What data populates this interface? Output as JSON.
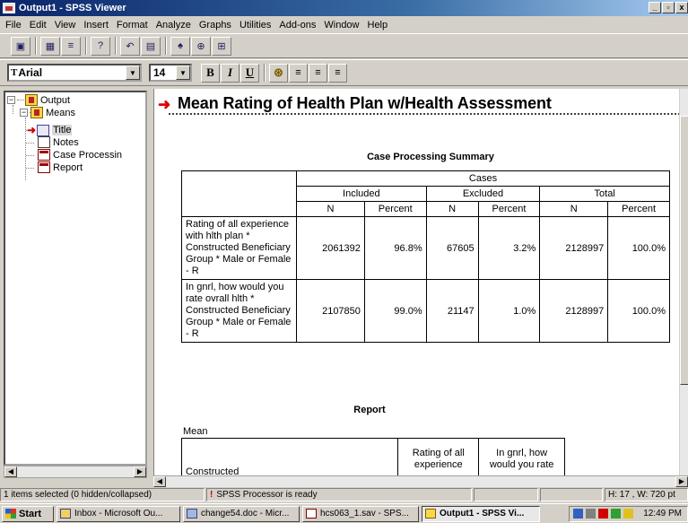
{
  "window": {
    "title": "Output1 - SPSS Viewer",
    "min": "_",
    "max": "▫",
    "close": "x"
  },
  "menu": [
    "File",
    "Edit",
    "View",
    "Insert",
    "Format",
    "Analyze",
    "Graphs",
    "Utilities",
    "Add-ons",
    "Window",
    "Help"
  ],
  "format_bar": {
    "font": "Arial",
    "size": "14",
    "bold": "B",
    "italic": "I",
    "underline": "U"
  },
  "tree": {
    "output": "Output",
    "means": "Means",
    "title": "Title",
    "notes": "Notes",
    "case_processing": "Case Processin",
    "report": "Report"
  },
  "content": {
    "heading": "Mean Rating of Health Plan w/Health Assessment",
    "case_table": {
      "title": "Case Processing Summary",
      "group_header": "Cases",
      "groups": [
        "Included",
        "Excluded",
        "Total"
      ],
      "subheaders": [
        "N",
        "Percent",
        "N",
        "Percent",
        "N",
        "Percent"
      ],
      "rows": [
        {
          "label": "Rating of all experience with hlth plan  * Constructed Beneficiary Group * Male or Female  - R",
          "values": [
            "2061392",
            "96.8%",
            "67605",
            "3.2%",
            "2128997",
            "100.0%"
          ]
        },
        {
          "label": "In gnrl, how would you rate ovrall hlth  * Constructed Beneficiary Group * Male or Female  - R",
          "values": [
            "2107850",
            "99.0%",
            "21147",
            "1.0%",
            "2128997",
            "100.0%"
          ]
        }
      ]
    },
    "report": {
      "title": "Report",
      "subtitle": "Mean",
      "col_constructed": "Constructed",
      "col_rating": "Rating of all experience",
      "col_gnrl": "In gnrl, how would you rate"
    }
  },
  "statusbar": {
    "selection": "1 items selected (0 hidden/collapsed)",
    "processor": "SPSS Processor  is ready",
    "dims": "H: 17 , W: 720  pt"
  },
  "taskbar": {
    "start": "Start",
    "tasks": [
      "Inbox - Microsoft Ou...",
      "change54.doc - Micr...",
      "hcs063_1.sav - SPS...",
      "Output1 - SPSS Vi..."
    ],
    "clock": "12:49 PM"
  }
}
